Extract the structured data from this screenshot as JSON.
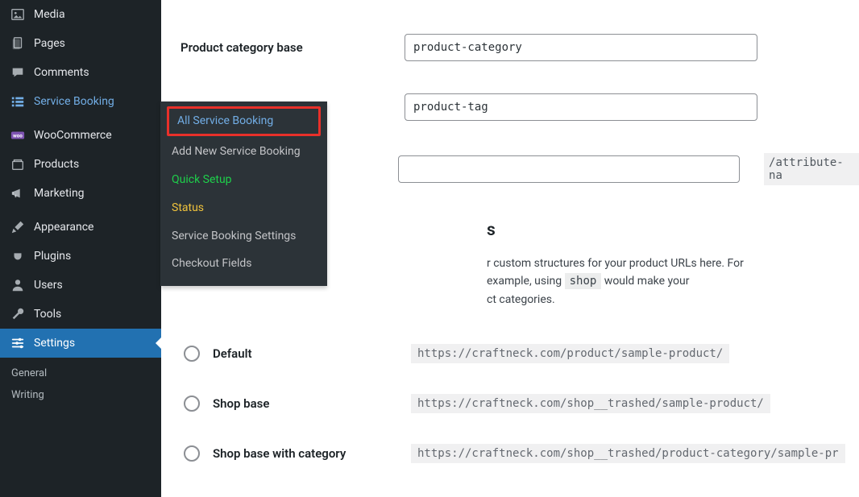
{
  "sidebar": {
    "items": [
      {
        "label": "Media"
      },
      {
        "label": "Pages"
      },
      {
        "label": "Comments"
      },
      {
        "label": "Service Booking"
      },
      {
        "label": "WooCommerce"
      },
      {
        "label": "Products"
      },
      {
        "label": "Marketing"
      },
      {
        "label": "Appearance"
      },
      {
        "label": "Plugins"
      },
      {
        "label": "Users"
      },
      {
        "label": "Tools"
      },
      {
        "label": "Settings"
      }
    ],
    "settings_sub": [
      {
        "label": "General"
      },
      {
        "label": "Writing"
      }
    ]
  },
  "flyout": {
    "items": [
      {
        "label": "All Service Booking"
      },
      {
        "label": "Add New Service Booking"
      },
      {
        "label": "Quick Setup"
      },
      {
        "label": "Status"
      },
      {
        "label": "Service Booking Settings"
      },
      {
        "label": "Checkout Fields"
      }
    ]
  },
  "form": {
    "category_label": "Product category base",
    "category_value": "product-category",
    "tag_value": "product-tag",
    "attr_value": "",
    "attr_suffix": "/attribute-na"
  },
  "section": {
    "heading_suffix": "s",
    "desc_prefix": "r custom structures for your product URLs here. For example, using ",
    "desc_code": "shop",
    "desc_mid": " would make your ",
    "desc_line2": "ct categories."
  },
  "permalinks": {
    "options": [
      {
        "label": "Default",
        "url": "https://craftneck.com/product/sample-product/"
      },
      {
        "label": "Shop base",
        "url": "https://craftneck.com/shop__trashed/sample-product/"
      },
      {
        "label": "Shop base with category",
        "url": "https://craftneck.com/shop__trashed/product-category/sample-pr"
      }
    ]
  }
}
